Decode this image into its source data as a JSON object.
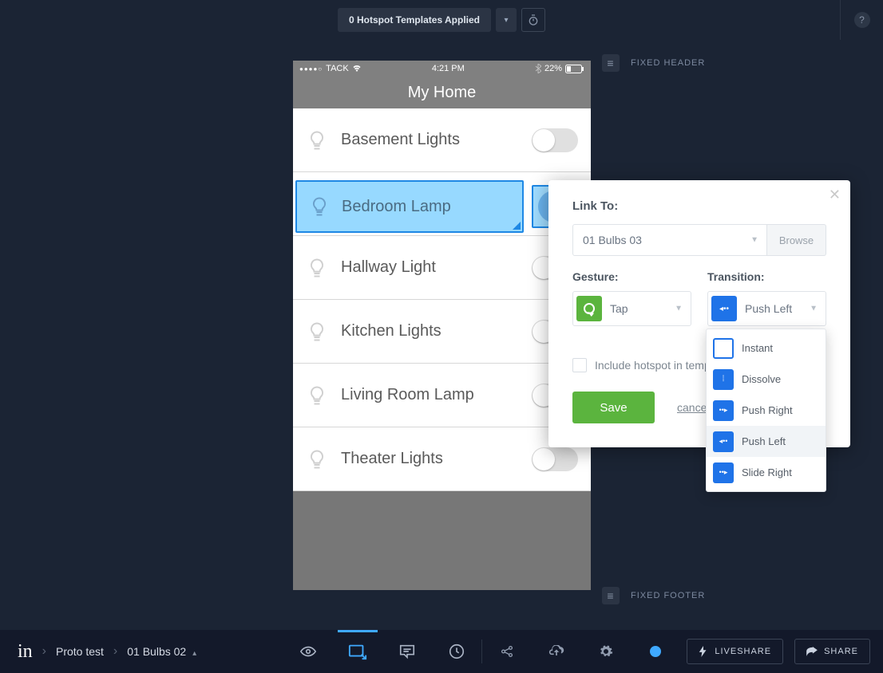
{
  "topbar": {
    "templates_label": "0 Hotspot Templates Applied"
  },
  "regions": {
    "header_label": "FIXED HEADER",
    "footer_label": "FIXED FOOTER"
  },
  "phone": {
    "status": {
      "carrier": "TACK",
      "time": "4:21 PM",
      "battery": "22%"
    },
    "title": "My Home",
    "rows": [
      {
        "label": "Basement  Lights",
        "on": false
      },
      {
        "label": "Bedroom Lamp",
        "on": true
      },
      {
        "label": "Hallway Light",
        "on": false
      },
      {
        "label": "Kitchen Lights",
        "on": false
      },
      {
        "label": "Living Room Lamp",
        "on": false
      },
      {
        "label": "Theater Lights",
        "on": false
      }
    ]
  },
  "popover": {
    "linkto_label": "Link To:",
    "linkto_value": "01 Bulbs 03",
    "browse_label": "Browse",
    "gesture_label": "Gesture:",
    "gesture_value": "Tap",
    "transition_label": "Transition:",
    "transition_value": "Push Left",
    "include_label": "Include hotspot in template",
    "save_label": "Save",
    "cancel_label": "cancel"
  },
  "dropdown": {
    "options": [
      {
        "label": "Instant",
        "kind": "empty"
      },
      {
        "label": "Dissolve",
        "kind": "dots"
      },
      {
        "label": "Push Right",
        "kind": "right"
      },
      {
        "label": "Push Left",
        "kind": "left",
        "selected": true
      },
      {
        "label": "Slide Right",
        "kind": "right2"
      }
    ]
  },
  "bottombar": {
    "project": "Proto test",
    "screen": "01 Bulbs 02",
    "liveshare": "LIVESHARE",
    "share": "SHARE"
  }
}
